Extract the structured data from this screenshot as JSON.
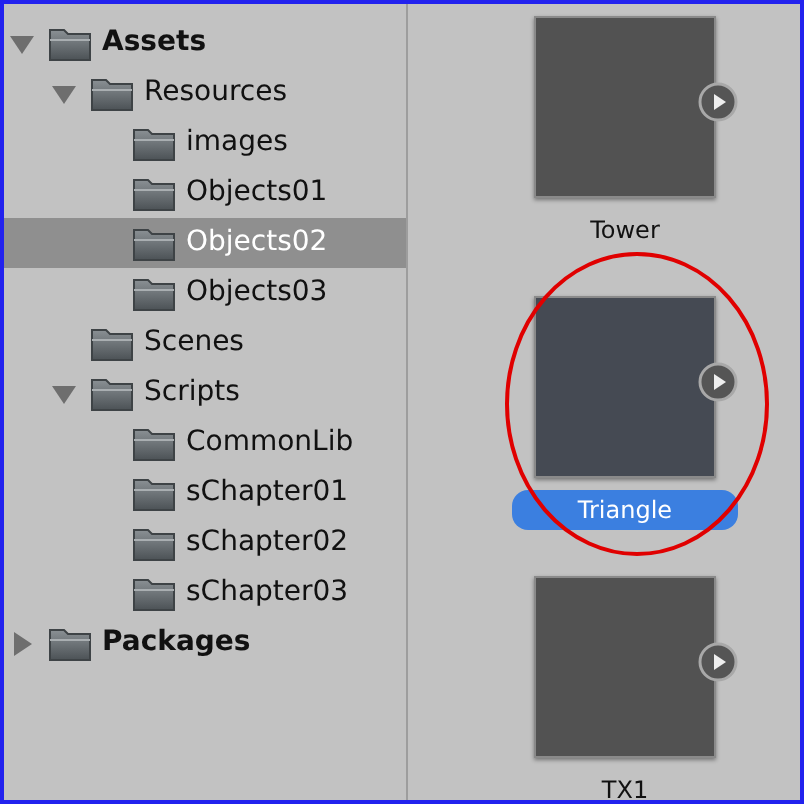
{
  "tree": [
    {
      "label": "Assets",
      "bold": true,
      "expanded": true,
      "selected": false,
      "children": [
        {
          "label": "Resources",
          "bold": false,
          "expanded": true,
          "selected": false,
          "children": [
            {
              "label": "images",
              "bold": false,
              "selected": false
            },
            {
              "label": "Objects01",
              "bold": false,
              "selected": false
            },
            {
              "label": "Objects02",
              "bold": false,
              "selected": true
            },
            {
              "label": "Objects03",
              "bold": false,
              "selected": false
            }
          ]
        },
        {
          "label": "Scenes",
          "bold": false,
          "selected": false
        },
        {
          "label": "Scripts",
          "bold": false,
          "expanded": true,
          "selected": false,
          "children": [
            {
              "label": "CommonLib",
              "bold": false,
              "selected": false
            },
            {
              "label": "sChapter01",
              "bold": false,
              "selected": false
            },
            {
              "label": "sChapter02",
              "bold": false,
              "selected": false
            },
            {
              "label": "sChapter03",
              "bold": false,
              "selected": false
            }
          ]
        }
      ]
    },
    {
      "label": "Packages",
      "bold": true,
      "expanded": false,
      "selected": false
    }
  ],
  "assets": [
    {
      "label": "Tower",
      "selected": false
    },
    {
      "label": "Triangle",
      "selected": true
    },
    {
      "label": "TX1",
      "selected": false
    }
  ],
  "annotation": {
    "kind": "ellipse",
    "color": "#e00000"
  }
}
